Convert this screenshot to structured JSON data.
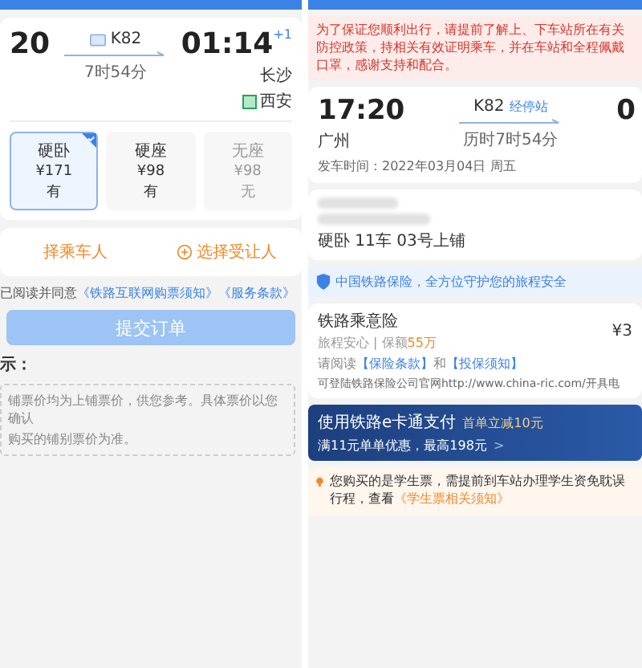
{
  "left_panel": {
    "train": {
      "departure_time": "20",
      "train_number": "K82",
      "duration": "7时54分",
      "arrival_time": "01:14",
      "day_offset": "+1",
      "arrival_station": "长沙",
      "origin_station": "西安"
    },
    "seats": [
      {
        "name": "硬卧",
        "price": "¥171",
        "availability": "有",
        "selected": true,
        "disabled": false
      },
      {
        "name": "硬座",
        "price": "¥98",
        "availability": "有",
        "selected": false,
        "disabled": false
      },
      {
        "name": "无座",
        "price": "¥98",
        "availability": "无",
        "selected": false,
        "disabled": true
      }
    ],
    "passenger_buttons": [
      {
        "label": "择乘车人",
        "kind": "plain"
      },
      {
        "label": "选择受让人",
        "kind": "add"
      }
    ],
    "agreement": {
      "text": "已阅读并同意",
      "links": [
        "《铁路互联网购票须知》",
        "《服务条款》"
      ]
    },
    "submit": {
      "label": "提交订单",
      "disabled": true
    },
    "tips": {
      "title": "示：",
      "lines": [
        "铺票价均为上铺票价，供您参考。具体票价以您确认",
        "购买的铺别票价为准。"
      ]
    }
  },
  "right_panel": {
    "notice": "为了保证您顺利出行，请提前了解上、下车站所在有关防控政策，持相关有效证明乘车，并在车站和全程佩戴口罩，感谢支持和配合。",
    "train": {
      "departure_time": "17:20",
      "departure_station": "广州",
      "train_number": "K82",
      "stops_link": "经停站",
      "duration": "历时7时54分",
      "arrival_time": "0",
      "date": "发车时间：2022年03月04日 周五"
    },
    "seat_info": "硬卧 11车 03号上铺",
    "insurance": {
      "banner": "中国铁路保险，全方位守护您的旅程安全",
      "name": "铁路乘意险",
      "desc": "旅程安心 | 保额",
      "coverage": "55万",
      "price": "¥3",
      "read_prefix": "请阅读",
      "read_links": [
        "【保险条款】",
        "【投保须知】"
      ],
      "read_joiner": "和",
      "website": "可登陆铁路保险公司官网http://www.china-ric.com/开具电"
    },
    "ecard": {
      "title": "使用铁路e卡通支付",
      "badge": "首单立减10元",
      "subtitle": "满11元单单优惠，最高198元",
      "chevron": ">"
    },
    "student_notice": {
      "text": "您购买的是学生票，需提前到车站办理学生资免耽误行程，查看",
      "link": "《学生票相关须知》"
    }
  }
}
